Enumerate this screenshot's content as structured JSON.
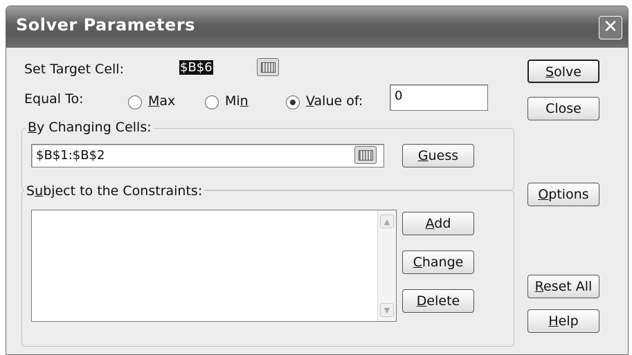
{
  "window": {
    "title": "Solver Parameters"
  },
  "target": {
    "label": "Set Target Cell:",
    "value": "$B$6"
  },
  "equal_to": {
    "label": "Equal To:",
    "options": [
      {
        "pre": "",
        "key": "M",
        "post": "ax",
        "selected": false
      },
      {
        "pre": "Mi",
        "key": "n",
        "post": "",
        "selected": false
      },
      {
        "pre": "",
        "key": "V",
        "post": "alue of:",
        "selected": true
      }
    ],
    "value_of": "0"
  },
  "changing": {
    "label_key": "B",
    "label_rest": "y Changing Cells:",
    "value": "$B$1:$B$2"
  },
  "constraints": {
    "label_pre": "S",
    "label_key": "u",
    "label_rest": "bject to the Constraints:",
    "items": []
  },
  "buttons": {
    "solve": {
      "key": "S",
      "rest": "olve"
    },
    "close": {
      "label": "Close"
    },
    "guess": {
      "key": "G",
      "rest": "uess"
    },
    "options": {
      "key": "O",
      "rest": "ptions"
    },
    "add": {
      "key": "A",
      "rest": "dd"
    },
    "change": {
      "key": "C",
      "rest": "hange"
    },
    "delete": {
      "key": "D",
      "rest": "elete"
    },
    "reset": {
      "key": "R",
      "rest": "eset All"
    },
    "help": {
      "key": "H",
      "rest": "elp"
    }
  },
  "icons": {
    "close": "close-icon",
    "ref": "range-selector-icon",
    "scroll_up": "scroll-up-arrow-icon",
    "scroll_down": "scroll-down-arrow-icon"
  }
}
